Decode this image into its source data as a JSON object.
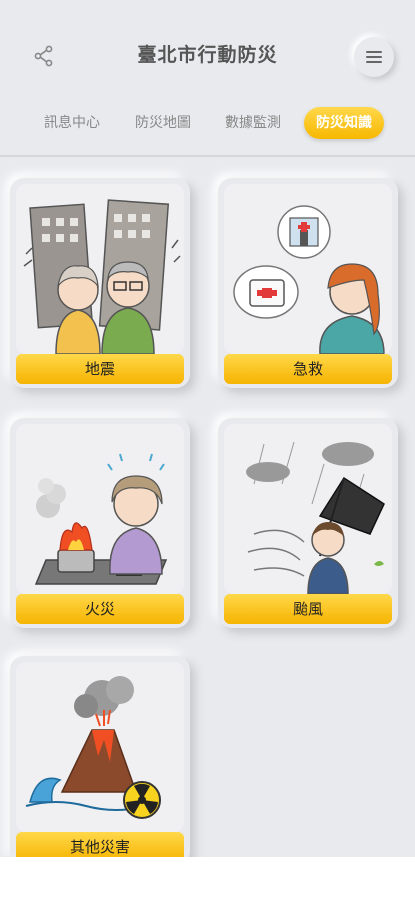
{
  "header": {
    "title": "臺北市行動防災",
    "share_icon": "share-icon",
    "menu_icon": "hamburger-menu-icon"
  },
  "tabs": [
    {
      "label": "訊息中心",
      "active": false
    },
    {
      "label": "防災地圖",
      "active": false
    },
    {
      "label": "數據監測",
      "active": false
    },
    {
      "label": "防災知識",
      "active": true
    }
  ],
  "cards": [
    {
      "label": "地震",
      "icon": "earthquake-illustration"
    },
    {
      "label": "急救",
      "icon": "first-aid-illustration"
    },
    {
      "label": "火災",
      "icon": "fire-illustration"
    },
    {
      "label": "颱風",
      "icon": "typhoon-illustration"
    },
    {
      "label": "其他災害",
      "icon": "other-disasters-illustration"
    }
  ],
  "colors": {
    "accent": "#f7b800",
    "background": "#e9eaee"
  }
}
